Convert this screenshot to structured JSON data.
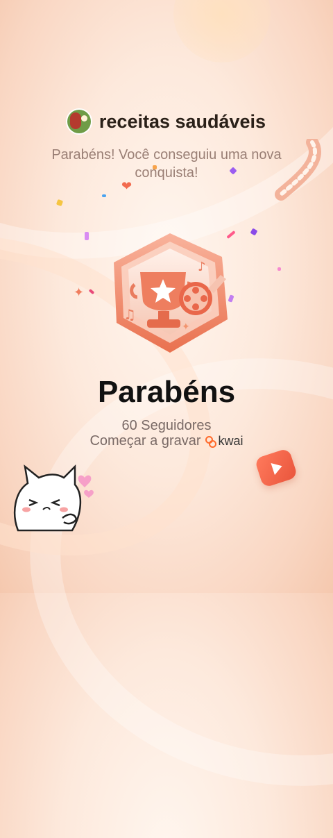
{
  "channel": {
    "name": "receitas saudáveis"
  },
  "message": "Parabéns! Você conseguiu uma nova conquista!",
  "achievement": {
    "title": "Parabéns",
    "followers": "60 Seguidores",
    "cta": "Começar a gravar",
    "brand": "kwai"
  },
  "icons": {
    "avatar": "channel-avatar",
    "badge": "trophy-film-badge-icon",
    "play": "play-icon",
    "cat": "cat-sticker-icon",
    "film": "film-strip-icon",
    "heart": "heart-icon",
    "sparkle": "sparkle-icon"
  },
  "colors": {
    "accent": "#f26b4f",
    "brand_kwai": "#ff6a2b",
    "title": "#111111",
    "muted": "#7a6a66"
  }
}
